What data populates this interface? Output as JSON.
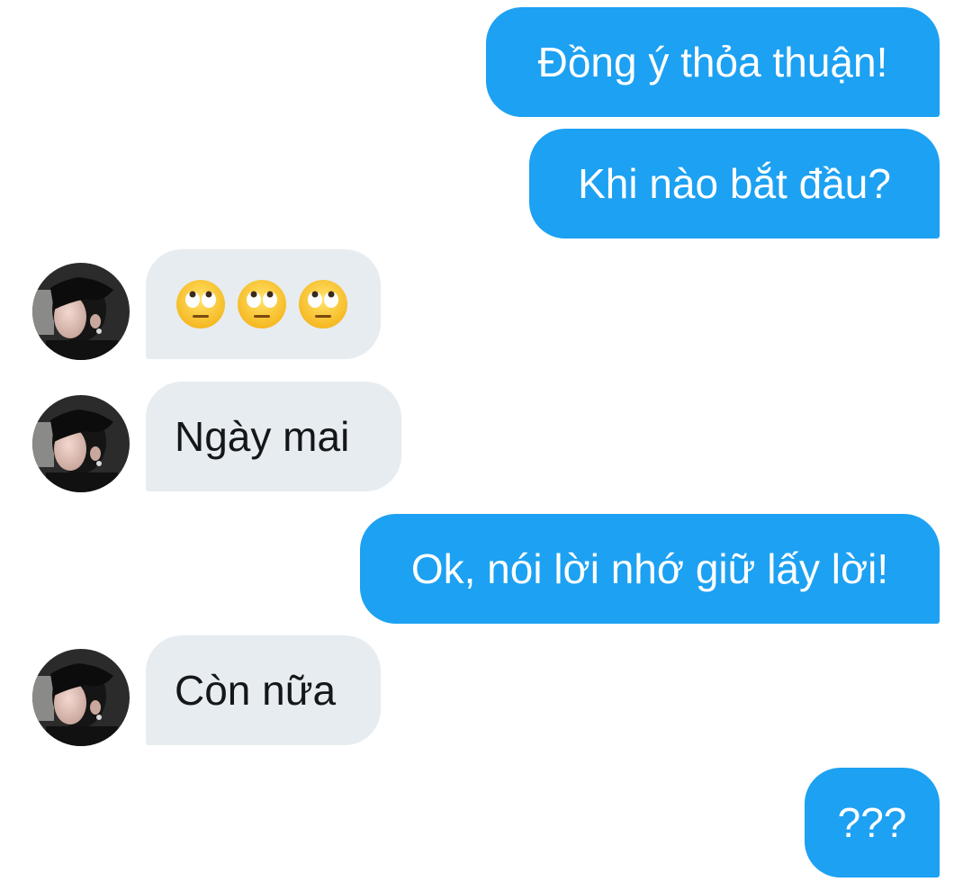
{
  "conversation": {
    "messages": [
      {
        "id": "m1",
        "direction": "outgoing",
        "text": "Đồng ý thỏa thuận!"
      },
      {
        "id": "m2",
        "direction": "outgoing",
        "text": "Khi nào bắt đầu?"
      },
      {
        "id": "m3",
        "direction": "incoming",
        "emoji": [
          "face-with-rolling-eyes",
          "face-with-rolling-eyes",
          "face-with-rolling-eyes"
        ]
      },
      {
        "id": "m4",
        "direction": "incoming",
        "text": "Ngày mai"
      },
      {
        "id": "m5",
        "direction": "outgoing",
        "text": "Ok, nói lời nhớ giữ lấy lời!"
      },
      {
        "id": "m6",
        "direction": "incoming",
        "text": "Còn nữa"
      },
      {
        "id": "m7",
        "direction": "outgoing",
        "text": "???"
      }
    ]
  },
  "colors": {
    "outgoing_bubble": "#1da1f2",
    "incoming_bubble": "#e6ecf0",
    "outgoing_text": "#ffffff",
    "incoming_text": "#14171a",
    "background": "#ffffff"
  }
}
